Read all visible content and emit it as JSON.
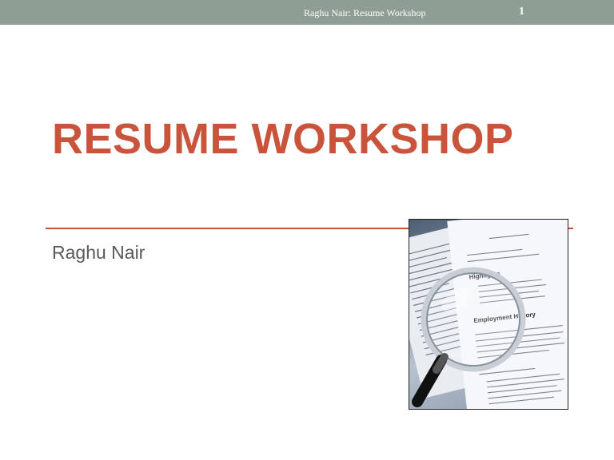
{
  "header": {
    "title": "Raghu Nair: Resume Workshop",
    "page_number": "1"
  },
  "slide": {
    "title": "RESUME WORKSHOP",
    "subtitle": "Raghu Nair"
  },
  "image": {
    "icon": "magnifying-glass-resume-photo",
    "headings": [
      "Highlights",
      "Employment History"
    ]
  },
  "colors": {
    "header_bar": "#8f9e94",
    "accent": "#c9533b",
    "subtitle_text": "#595959"
  }
}
